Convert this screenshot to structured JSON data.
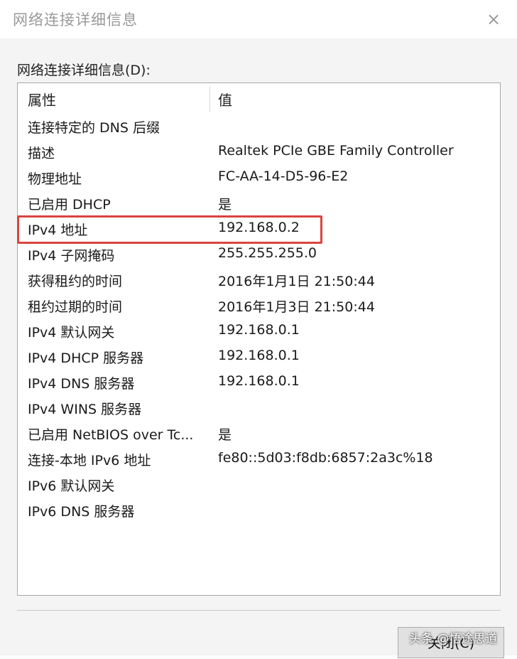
{
  "window": {
    "title": "网络连接详细信息",
    "close_glyph": "×"
  },
  "group_label": "网络连接详细信息(D):",
  "list": {
    "columns": {
      "property": "属性",
      "value": "值"
    },
    "rows": [
      {
        "property": "连接特定的 DNS 后缀",
        "value": ""
      },
      {
        "property": "描述",
        "value": "Realtek PCIe GBE Family Controller"
      },
      {
        "property": "物理地址",
        "value": "FC-AA-14-D5-96-E2"
      },
      {
        "property": "已启用 DHCP",
        "value": "是"
      },
      {
        "property": "IPv4 地址",
        "value": "192.168.0.2"
      },
      {
        "property": "IPv4 子网掩码",
        "value": "255.255.255.0"
      },
      {
        "property": "获得租约的时间",
        "value": "2016年1月1日 21:50:44"
      },
      {
        "property": "租约过期的时间",
        "value": "2016年1月3日 21:50:44"
      },
      {
        "property": "IPv4 默认网关",
        "value": "192.168.0.1"
      },
      {
        "property": "IPv4 DHCP 服务器",
        "value": "192.168.0.1"
      },
      {
        "property": "IPv4 DNS 服务器",
        "value": "192.168.0.1"
      },
      {
        "property": "IPv4 WINS 服务器",
        "value": ""
      },
      {
        "property": "已启用 NetBIOS over Tc...",
        "value": "是"
      },
      {
        "property": "连接-本地 IPv6 地址",
        "value": "fe80::5d03:f8db:6857:2a3c%18"
      },
      {
        "property": "IPv6 默认网关",
        "value": ""
      },
      {
        "property": "IPv6 DNS 服务器",
        "value": ""
      }
    ]
  },
  "buttons": {
    "close": "关闭(C)"
  },
  "watermark": "头条 @悟途思道",
  "colors": {
    "highlight": "#d9453f"
  }
}
